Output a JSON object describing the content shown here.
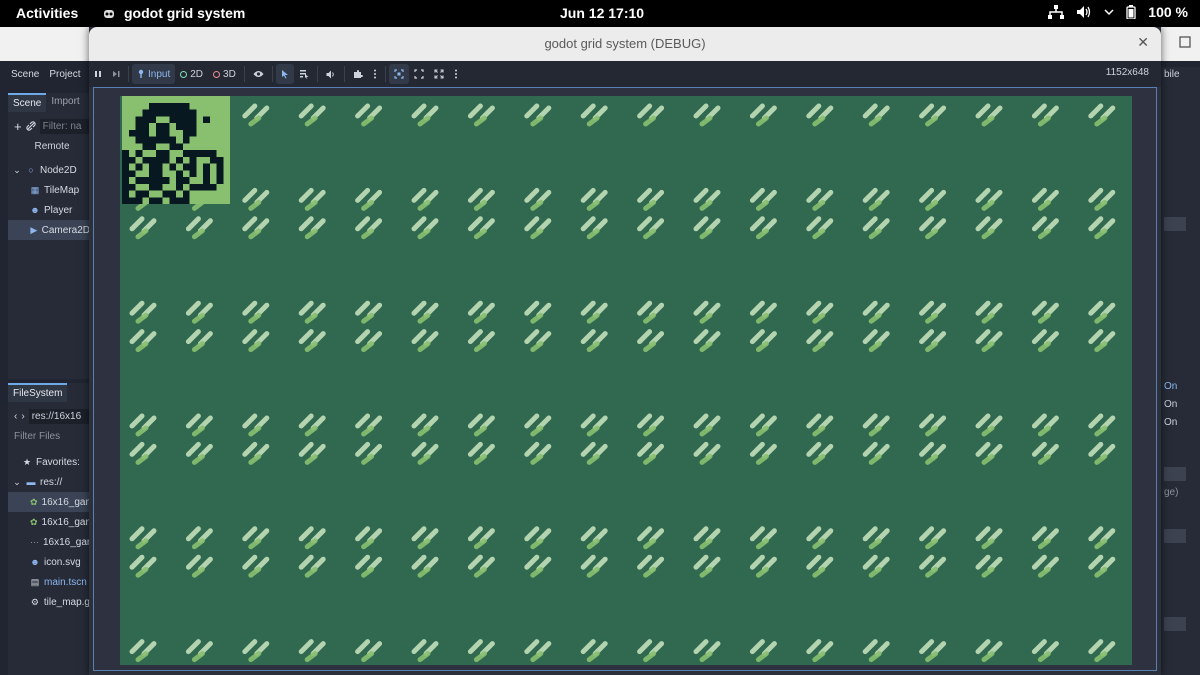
{
  "topbar": {
    "activities": "Activities",
    "app_name": "godot grid system",
    "clock": "Jun 12  17:10",
    "battery": "100 %"
  },
  "editor": {
    "menu": [
      "Scene",
      "Project",
      "D"
    ],
    "scene_dock": {
      "tabs": [
        "Scene",
        "Import"
      ],
      "filter_placeholder": "Filter: na",
      "remote_label": "Remote",
      "tree": [
        {
          "label": "Node2D",
          "icon": "circle-node-icon"
        },
        {
          "label": "TileMap",
          "icon": "tilemap-icon"
        },
        {
          "label": "Player",
          "icon": "player-icon"
        },
        {
          "label": "Camera2D",
          "icon": "camera-icon"
        }
      ]
    },
    "filesystem_dock": {
      "tab": "FileSystem",
      "path": "res://16x16",
      "filter_placeholder": "Filter Files",
      "favorites": "Favorites:",
      "root": "res://",
      "files": [
        {
          "label": "16x16_gam",
          "icon": "image-icon"
        },
        {
          "label": "16x16_gam",
          "icon": "image-icon"
        },
        {
          "label": "16x16_gam",
          "icon": "dotted-file-icon"
        },
        {
          "label": "icon.svg",
          "icon": "godot-icon"
        },
        {
          "label": "main.tscn",
          "icon": "scene-icon"
        },
        {
          "label": "tile_map.g",
          "icon": "gear-icon"
        }
      ]
    },
    "right_dock": {
      "bile": "bile",
      "on": [
        "On",
        "On",
        "On"
      ],
      "ge": "ge)"
    }
  },
  "game_window": {
    "title": "godot grid system (DEBUG)",
    "toolbar": {
      "input": "Input",
      "mode_2d": "2D",
      "mode_3d": "3D"
    },
    "resolution": "1152x648",
    "colors": {
      "bg": "#306850",
      "leaf_light": "#88c070",
      "leaf_dark": "#e0f8d0",
      "sprite_dark": "#081820",
      "sprite_light": "#88c070"
    }
  }
}
